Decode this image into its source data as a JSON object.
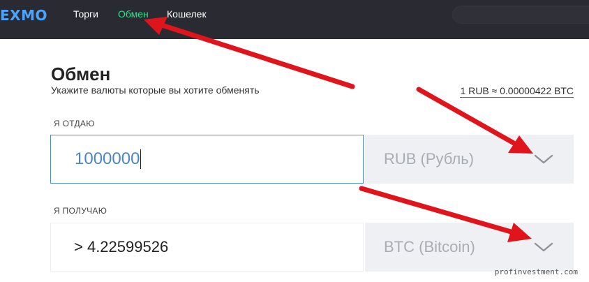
{
  "header": {
    "logo": "EXMO",
    "nav": [
      {
        "label": "Торги",
        "active": false
      },
      {
        "label": "Обмен",
        "active": true
      },
      {
        "label": "Кошелек",
        "active": false
      }
    ]
  },
  "exchange": {
    "title": "Обмен",
    "subtitle": "Укажите валюты которые вы хотите обменять",
    "rate": "1 RUB ≈ 0.00000422 BTC",
    "give": {
      "label": "Я ОТДАЮ",
      "value": "1000000",
      "currency": "RUB (Рубль)"
    },
    "get": {
      "label": "Я ПОЛУЧАЮ",
      "value": "> 4.22599526",
      "currency": "BTC (Bitcoin)"
    }
  },
  "colors": {
    "nav_bg": "#2a2b32",
    "logo": "#4aa3ff",
    "nav_active": "#2ee08b",
    "input_border": "#4a8bd6",
    "select_bg": "#eef0f3",
    "annotation_arrow": "#e0141b"
  },
  "icons": {
    "select_chevron": "chevron-down-icon",
    "annotation": "red-arrow"
  },
  "watermark": "profinvestment.com"
}
